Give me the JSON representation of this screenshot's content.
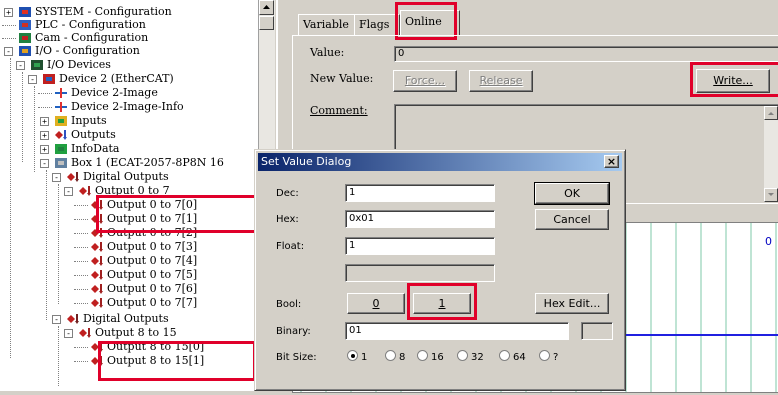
{
  "tree": {
    "nodes": [
      {
        "label": "SYSTEM - Configuration",
        "icon": "system-config-icon",
        "expander": "+"
      },
      {
        "label": "PLC - Configuration",
        "icon": "plc-config-icon",
        "expander": ""
      },
      {
        "label": "Cam - Configuration",
        "icon": "cam-config-icon",
        "expander": ""
      },
      {
        "label": "I/O - Configuration",
        "icon": "io-config-icon",
        "expander": "-"
      },
      {
        "label": "I/O Devices",
        "icon": "io-devices-icon",
        "expander": "-"
      },
      {
        "label": "Device 2 (EtherCAT)",
        "icon": "ethercat-device-icon",
        "expander": "-"
      },
      {
        "label": "Device 2-Image",
        "icon": "device-image-icon",
        "expander": ""
      },
      {
        "label": "Device 2-Image-Info",
        "icon": "device-image-info-icon",
        "expander": ""
      },
      {
        "label": "Inputs",
        "icon": "inputs-icon",
        "expander": "+"
      },
      {
        "label": "Outputs",
        "icon": "outputs-icon",
        "expander": "+"
      },
      {
        "label": "InfoData",
        "icon": "infodata-icon",
        "expander": "+"
      },
      {
        "label": "Box 1 (ECAT-2057-8P8N 16",
        "icon": "box-icon",
        "expander": "-"
      },
      {
        "label": "Digital Outputs",
        "icon": "digital-outputs-icon",
        "expander": "-"
      },
      {
        "label": "Output 0 to 7",
        "icon": "output-group-icon",
        "expander": "-"
      },
      {
        "label": "Output 0 to 7[0]",
        "icon": "output-bit-icon",
        "expander": ""
      },
      {
        "label": "Output 0 to 7[1]",
        "icon": "output-bit-icon",
        "expander": ""
      },
      {
        "label": "Output 0 to 7[2]",
        "icon": "output-bit-icon",
        "expander": ""
      },
      {
        "label": "Output 0 to 7[3]",
        "icon": "output-bit-icon",
        "expander": ""
      },
      {
        "label": "Output 0 to 7[4]",
        "icon": "output-bit-icon",
        "expander": ""
      },
      {
        "label": "Output 0 to 7[5]",
        "icon": "output-bit-icon",
        "expander": ""
      },
      {
        "label": "Output 0 to 7[6]",
        "icon": "output-bit-icon",
        "expander": ""
      },
      {
        "label": "Output 0 to 7[7]",
        "icon": "output-bit-icon",
        "expander": ""
      },
      {
        "label": "Digital Outputs",
        "icon": "digital-outputs-icon",
        "expander": "-"
      },
      {
        "label": "Output 8 to 15",
        "icon": "output-group-icon",
        "expander": "-"
      },
      {
        "label": "Output 8 to 15[0]",
        "icon": "output-bit-icon",
        "expander": ""
      },
      {
        "label": "Output 8 to 15[1]",
        "icon": "output-bit-icon",
        "expander": ""
      }
    ]
  },
  "tabs": [
    {
      "label": "Variable"
    },
    {
      "label": "Flags"
    },
    {
      "label": "Online"
    }
  ],
  "online": {
    "value_label": "Value:",
    "value": "0",
    "new_value_label": "New Value:",
    "force_label": "Force...",
    "release_label": "Release",
    "write_label": "Write...",
    "comment_label": "Comment:",
    "chart_value": "0"
  },
  "dialog": {
    "title": "Set Value Dialog",
    "close_glyph": "×",
    "dec_label": "Dec:",
    "dec_value": "1",
    "hex_label": "Hex:",
    "hex_value": "0x01",
    "float_label": "Float:",
    "float_value": "1",
    "bool_label": "Bool:",
    "bool0_label": "0",
    "bool1_label": "1",
    "binary_label": "Binary:",
    "binary_value": "01",
    "bitsize_label": "Bit Size:",
    "ok_label": "OK",
    "cancel_label": "Cancel",
    "hexedit_label": "Hex Edit...",
    "bitsize_options": [
      {
        "label": "1",
        "selected": true
      },
      {
        "label": "8",
        "selected": false
      },
      {
        "label": "16",
        "selected": false
      },
      {
        "label": "32",
        "selected": false
      },
      {
        "label": "64",
        "selected": false
      },
      {
        "label": "?",
        "selected": false
      }
    ]
  },
  "colors": {
    "highlight": "#e0002a",
    "title_start": "#0a246a",
    "title_end": "#a6caf0",
    "chart_grid": "#7fc9a8",
    "chart_line": "#2020e0",
    "chart_text": "#0000c0"
  }
}
